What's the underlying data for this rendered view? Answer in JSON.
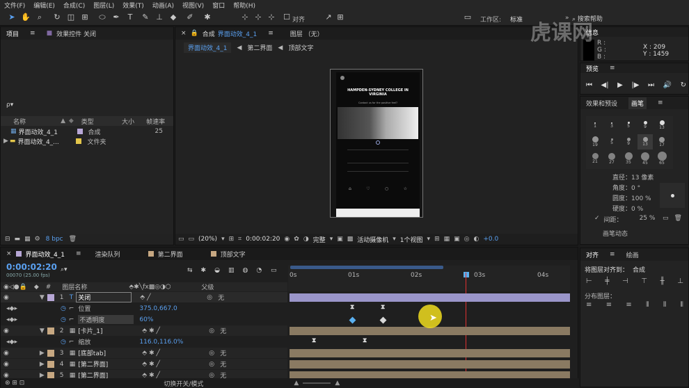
{
  "menu": [
    "文件(F)",
    "编辑(E)",
    "合成(C)",
    "图层(L)",
    "效果(T)",
    "动画(A)",
    "视图(V)",
    "窗口",
    "帮助(H)"
  ],
  "toolbar": {
    "snap_label": "对齐",
    "workspace_label": "工作区:",
    "workspace_value": "标准",
    "search_placeholder": "搜索帮助"
  },
  "project": {
    "tab": "项目",
    "effects_tab": "效果控件 关闭",
    "search": "ρ▾",
    "columns": {
      "name": "名称",
      "type": "类型",
      "size": "大小",
      "fps": "帧速率"
    },
    "items": [
      {
        "name": "界面动效_4_1",
        "type": "合成",
        "fps": "25",
        "color": "#b7a7d6"
      },
      {
        "name": "界面动效_4_...",
        "type": "文件夹",
        "fps": "",
        "color": "#e3c64a"
      }
    ],
    "bpc": "8 bpc"
  },
  "composition": {
    "tab_prefix": "合成",
    "tab_name": "界面动效_4_1",
    "layer_tab": "图层 （无）",
    "breadcrumbs": [
      "界面动效_4_1",
      "第二界面",
      "顶部文字"
    ],
    "zoom": "(20%)",
    "timecode": "0:00:02:20",
    "quality": "完整",
    "camera": "活动摄像机",
    "views": "1个视图",
    "offset": "+0.0"
  },
  "preview": {
    "title": "HAMPDEN-SYDNEY COLLEGE IN VIRGINIA",
    "subtitle": "Contact us for the positive feel?"
  },
  "info": {
    "tab": "信息",
    "r": "R :",
    "g": "G :",
    "b": "B :",
    "x": "X : 209",
    "y": "Y : 1459",
    "preview_tab": "预览"
  },
  "brushes": {
    "effects_tab": "效果和预设",
    "brush_tab": "画笔",
    "sizes": [
      "1",
      "3",
      "5",
      "9",
      "13",
      "19",
      "5",
      "9",
      "13",
      "17",
      "21",
      "27",
      "35",
      "45",
      "65"
    ],
    "diameter": "直径：13 像素",
    "angle": "角度：0 °",
    "roundness": "圆度：100 %",
    "hardness": "硬度：0 %",
    "spacing": "间距：",
    "spacing_value": "25 %",
    "dynamics": "画笔动态"
  },
  "align": {
    "tab": "对齐",
    "paint_tab": "绘画",
    "align_to_label": "将图层对齐到：",
    "align_to_value": "合成",
    "distribute_label": "分布图层："
  },
  "timeline": {
    "tab": "界面动效_4_1",
    "render_tab": "渲染队列",
    "tab2": "第二界面",
    "tab3": "顶部文字",
    "timecode": "0:00:02:20",
    "fps": "00070 (25.00 fps)",
    "layer_name_header": "图层名称",
    "parent_header": "父级",
    "ruler": [
      "0s",
      "01s",
      "02s",
      "03s",
      "04s"
    ],
    "footer": "切换开关/模式",
    "layers": [
      {
        "num": "1",
        "name": "关闭",
        "parent": "无",
        "color": "#b7a7d6"
      },
      {
        "prop": "位置",
        "value": "375.0,667.0"
      },
      {
        "prop": "不透明度",
        "value": "60%"
      },
      {
        "num": "2",
        "name": "[卡片_1]",
        "parent": "无",
        "color": "#c7a882"
      },
      {
        "prop": "缩放",
        "value": "116.0,116.0%"
      },
      {
        "num": "3",
        "name": "[底部tab]",
        "parent": "无",
        "color": "#c7a882"
      },
      {
        "num": "4",
        "name": "[第二界面]",
        "parent": "无",
        "color": "#c7a882"
      },
      {
        "num": "5",
        "name": "[第二界面]",
        "parent": "无",
        "color": "#c7a882"
      }
    ]
  },
  "watermark": "虎课网"
}
